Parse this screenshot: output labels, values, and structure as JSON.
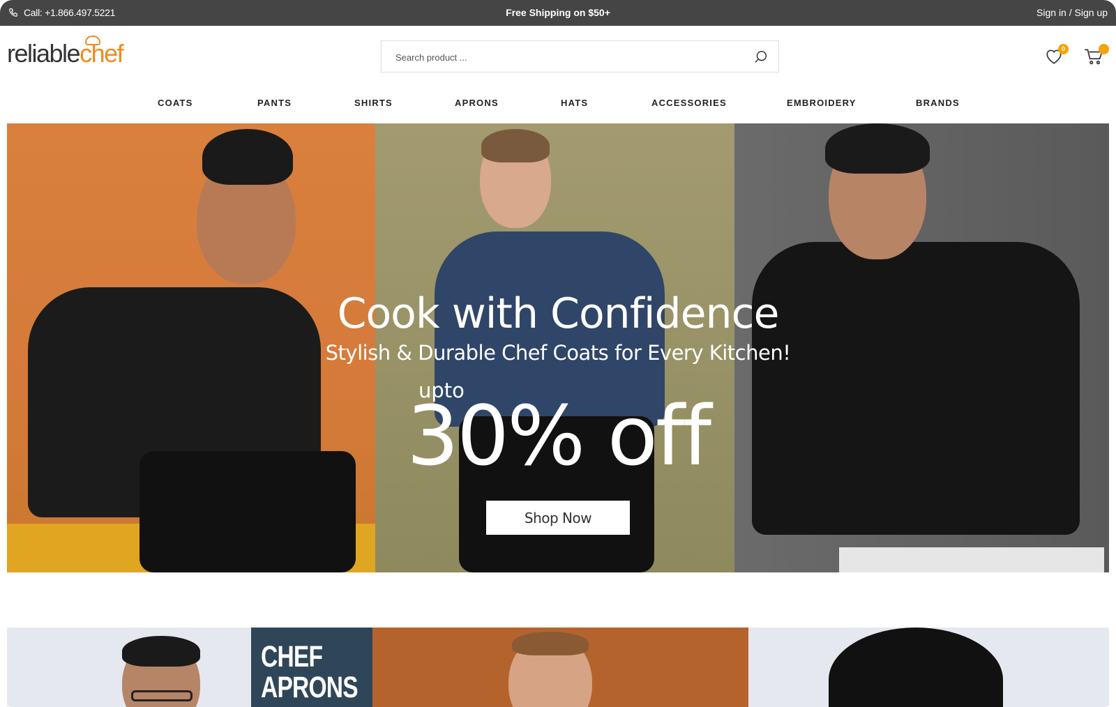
{
  "topbar": {
    "call": "Call: +1.866.497.5221",
    "shipping": "Free Shipping on $50+",
    "auth": "Sign in / Sign up"
  },
  "header": {
    "logo_part1": "reliable",
    "logo_part2": "chef",
    "search_placeholder": "Search product ...",
    "wishlist_count": "0",
    "cart_count": ""
  },
  "nav": {
    "items": [
      "COATS",
      "PANTS",
      "SHIRTS",
      "APRONS",
      "HATS",
      "ACCESSORIES",
      "EMBROIDERY",
      "BRANDS"
    ]
  },
  "hero": {
    "title": "Cook with Confidence",
    "subtitle": "Stylish & Durable Chef Coats for Every Kitchen!",
    "upto": "upto",
    "discount": "30% off",
    "cta": "Shop Now"
  },
  "categories": {
    "aprons_label_line1": "CHEF",
    "aprons_label_line2": "APRONS"
  },
  "colors": {
    "accent": "#f08a1c",
    "topbar_bg": "#454545",
    "badge": "#f5a300"
  }
}
